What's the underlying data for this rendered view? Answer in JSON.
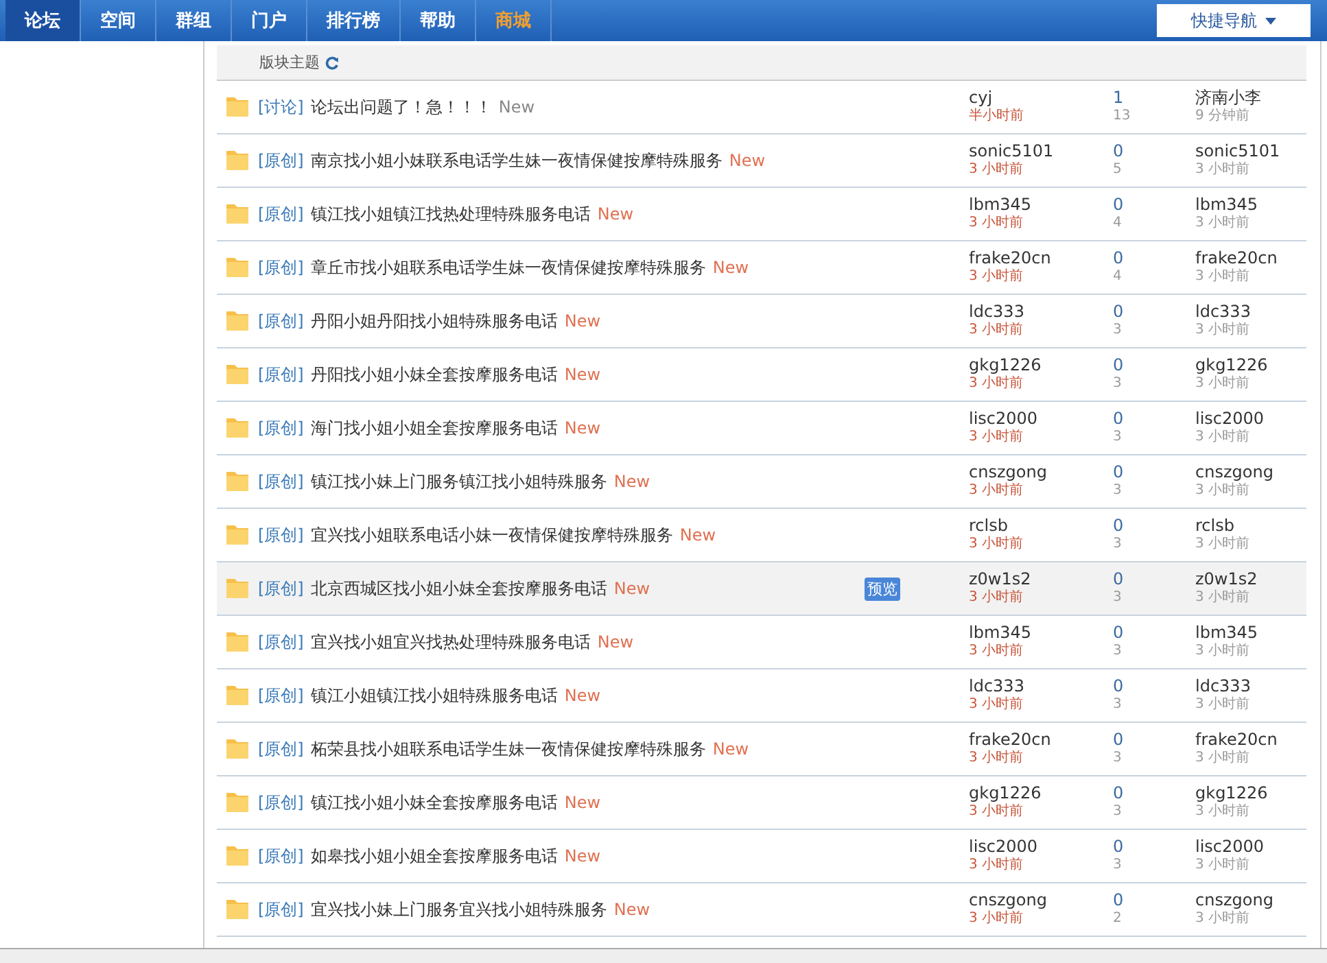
{
  "nav": [
    {
      "label": "论坛",
      "selected": true,
      "kind": "plain"
    },
    {
      "label": "空间",
      "selected": false,
      "kind": "plain"
    },
    {
      "label": "群组",
      "selected": false,
      "kind": "plain"
    },
    {
      "label": "门户",
      "selected": false,
      "kind": "plain"
    },
    {
      "label": "排行榜",
      "selected": false,
      "kind": "plain"
    },
    {
      "label": "帮助",
      "selected": false,
      "kind": "plain"
    },
    {
      "label": "商城",
      "selected": false,
      "kind": "shop"
    }
  ],
  "quick_nav": "快捷导航",
  "section_title": "版块主题",
  "threads": [
    {
      "kind": "plain",
      "type": "[讨论]",
      "title": "论坛出问题了！急！！！",
      "badge": "New",
      "author": "cyj",
      "author_time": "半小时前",
      "replies": "1",
      "views": "13",
      "last_user": "济南小李",
      "last_time": "9 分钟前",
      "highlighted": false
    },
    {
      "kind": "hot",
      "type": "[原创]",
      "title": "南京找小姐小妹联系电话学生妹一夜情保健按摩特殊服务",
      "badge": "New",
      "author": "sonic5101",
      "author_time": "3 小时前",
      "replies": "0",
      "views": "5",
      "last_user": "sonic5101",
      "last_time": "3 小时前",
      "highlighted": false
    },
    {
      "kind": "hot",
      "type": "[原创]",
      "title": "镇江找小姐镇江找热处理特殊服务电话",
      "badge": "New",
      "author": "lbm345",
      "author_time": "3 小时前",
      "replies": "0",
      "views": "4",
      "last_user": "lbm345",
      "last_time": "3 小时前",
      "highlighted": false
    },
    {
      "kind": "hot",
      "type": "[原创]",
      "title": "章丘市找小姐联系电话学生妹一夜情保健按摩特殊服务",
      "badge": "New",
      "author": "frake20cn",
      "author_time": "3 小时前",
      "replies": "0",
      "views": "4",
      "last_user": "frake20cn",
      "last_time": "3 小时前",
      "highlighted": false
    },
    {
      "kind": "hot",
      "type": "[原创]",
      "title": "丹阳小姐丹阳找小姐特殊服务电话",
      "badge": "New",
      "author": "ldc333",
      "author_time": "3 小时前",
      "replies": "0",
      "views": "3",
      "last_user": "ldc333",
      "last_time": "3 小时前",
      "highlighted": false
    },
    {
      "kind": "hot",
      "type": "[原创]",
      "title": "丹阳找小姐小妹全套按摩服务电话",
      "badge": "New",
      "author": "gkg1226",
      "author_time": "3 小时前",
      "replies": "0",
      "views": "3",
      "last_user": "gkg1226",
      "last_time": "3 小时前",
      "highlighted": false
    },
    {
      "kind": "hot",
      "type": "[原创]",
      "title": "海门找小姐小姐全套按摩服务电话",
      "badge": "New",
      "author": "lisc2000",
      "author_time": "3 小时前",
      "replies": "0",
      "views": "3",
      "last_user": "lisc2000",
      "last_time": "3 小时前",
      "highlighted": false
    },
    {
      "kind": "hot",
      "type": "[原创]",
      "title": "镇江找小妹上门服务镇江找小姐特殊服务",
      "badge": "New",
      "author": "cnszgong",
      "author_time": "3 小时前",
      "replies": "0",
      "views": "3",
      "last_user": "cnszgong",
      "last_time": "3 小时前",
      "highlighted": false
    },
    {
      "kind": "hot",
      "type": "[原创]",
      "title": "宜兴找小姐联系电话小妹一夜情保健按摩特殊服务",
      "badge": "New",
      "author": "rclsb",
      "author_time": "3 小时前",
      "replies": "0",
      "views": "3",
      "last_user": "rclsb",
      "last_time": "3 小时前",
      "highlighted": false
    },
    {
      "kind": "hot",
      "type": "[原创]",
      "title": "北京西城区找小姐小妹全套按摩服务电话",
      "badge": "New",
      "preview": "预览",
      "author": "z0w1s2",
      "author_time": "3 小时前",
      "replies": "0",
      "views": "3",
      "last_user": "z0w1s2",
      "last_time": "3 小时前",
      "highlighted": true
    },
    {
      "kind": "hot",
      "type": "[原创]",
      "title": "宜兴找小姐宜兴找热处理特殊服务电话",
      "badge": "New",
      "author": "lbm345",
      "author_time": "3 小时前",
      "replies": "0",
      "views": "3",
      "last_user": "lbm345",
      "last_time": "3 小时前",
      "highlighted": false
    },
    {
      "kind": "hot",
      "type": "[原创]",
      "title": "镇江小姐镇江找小姐特殊服务电话",
      "badge": "New",
      "author": "ldc333",
      "author_time": "3 小时前",
      "replies": "0",
      "views": "3",
      "last_user": "ldc333",
      "last_time": "3 小时前",
      "highlighted": false
    },
    {
      "kind": "hot",
      "type": "[原创]",
      "title": "柘荣县找小姐联系电话学生妹一夜情保健按摩特殊服务",
      "badge": "New",
      "author": "frake20cn",
      "author_time": "3 小时前",
      "replies": "0",
      "views": "3",
      "last_user": "frake20cn",
      "last_time": "3 小时前",
      "highlighted": false
    },
    {
      "kind": "hot",
      "type": "[原创]",
      "title": "镇江找小姐小妹全套按摩服务电话",
      "badge": "New",
      "author": "gkg1226",
      "author_time": "3 小时前",
      "replies": "0",
      "views": "3",
      "last_user": "gkg1226",
      "last_time": "3 小时前",
      "highlighted": false
    },
    {
      "kind": "hot",
      "type": "[原创]",
      "title": "如皋找小姐小姐全套按摩服务电话",
      "badge": "New",
      "author": "lisc2000",
      "author_time": "3 小时前",
      "replies": "0",
      "views": "3",
      "last_user": "lisc2000",
      "last_time": "3 小时前",
      "highlighted": false
    },
    {
      "kind": "hot",
      "type": "[原创]",
      "title": "宜兴找小妹上门服务宜兴找小姐特殊服务",
      "badge": "New",
      "author": "cnszgong",
      "author_time": "3 小时前",
      "replies": "0",
      "views": "2",
      "last_user": "cnszgong",
      "last_time": "3 小时前",
      "highlighted": false
    }
  ]
}
